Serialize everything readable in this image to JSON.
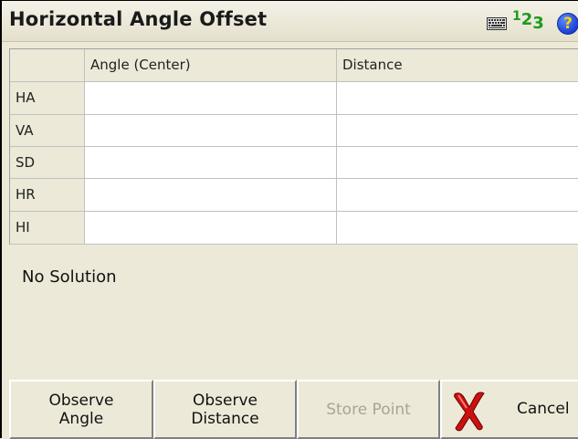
{
  "window": {
    "title": "Horizontal Angle Offset",
    "icons": [
      "keyboard-icon",
      "numeric-input-icon",
      "help-icon"
    ],
    "numeric_icon": {
      "sup": "1",
      "main": "2",
      "sub": "3"
    },
    "help_glyph": "?"
  },
  "table": {
    "columns": [
      "",
      "Angle (Center)",
      "Distance"
    ],
    "rows": [
      {
        "label": "HA",
        "angle": "",
        "distance": ""
      },
      {
        "label": "VA",
        "angle": "",
        "distance": ""
      },
      {
        "label": "SD",
        "angle": "",
        "distance": ""
      },
      {
        "label": "HR",
        "angle": "",
        "distance": ""
      },
      {
        "label": "HI",
        "angle": "",
        "distance": ""
      }
    ]
  },
  "status": {
    "message": "No Solution"
  },
  "buttons": {
    "observe_angle": "Observe\nAngle",
    "observe_distance": "Observe\nDistance",
    "store_point": "Store Point",
    "cancel": "Cancel"
  },
  "colors": {
    "accent_green": "#1e9a1e",
    "cancel_red": "#cc1010",
    "help_blue": "#1a3fd6"
  }
}
